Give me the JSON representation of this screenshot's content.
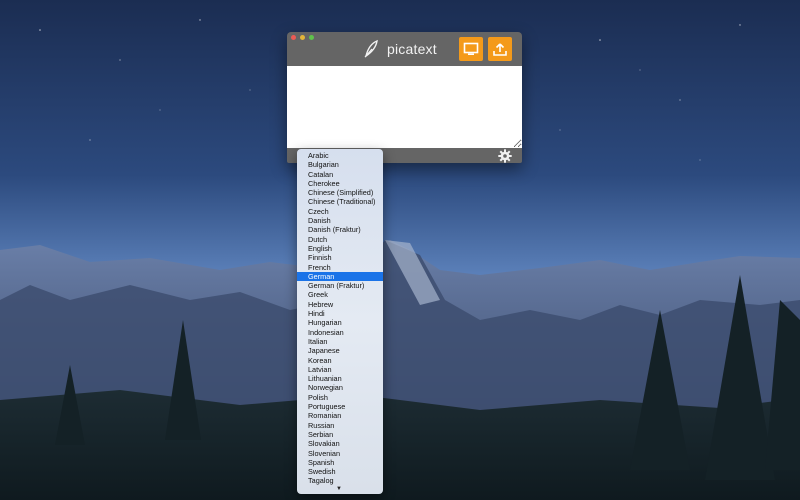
{
  "app": {
    "title": "picatext"
  },
  "toolbar": {
    "screen_icon": "screen-icon",
    "upload_icon": "upload-icon"
  },
  "settings": {
    "icon": "gear-icon"
  },
  "language_menu": {
    "selected": "German",
    "items": [
      "Arabic",
      "Bulgarian",
      "Catalan",
      "Cherokee",
      "Chinese (Simplified)",
      "Chinese (Traditional)",
      "Czech",
      "Danish",
      "Danish (Fraktur)",
      "Dutch",
      "English",
      "Finnish",
      "French",
      "German",
      "German (Fraktur)",
      "Greek",
      "Hebrew",
      "Hindi",
      "Hungarian",
      "Indonesian",
      "Italian",
      "Japanese",
      "Korean",
      "Latvian",
      "Lithuanian",
      "Norwegian",
      "Polish",
      "Portuguese",
      "Romanian",
      "Russian",
      "Serbian",
      "Slovakian",
      "Slovenian",
      "Spanish",
      "Swedish",
      "Tagalog"
    ],
    "scroll_indicator": "▼"
  },
  "colors": {
    "accent": "#f49a1a",
    "selection": "#1a73e8",
    "window": "#656565"
  }
}
